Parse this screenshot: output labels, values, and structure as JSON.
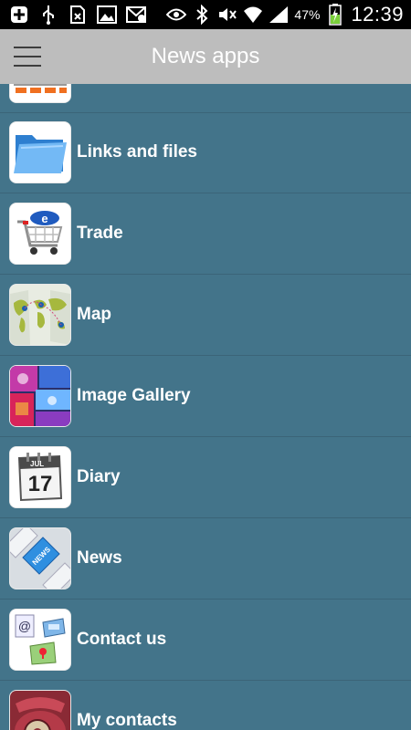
{
  "status_bar": {
    "battery_percent": "47%",
    "time": "12:39",
    "icons": [
      "plus-icon",
      "usb-icon",
      "no-sim-icon",
      "image-icon",
      "mail-icon",
      "eye-icon",
      "bluetooth-icon",
      "silent-icon",
      "wifi-icon",
      "signal-icon",
      "battery-charging-icon"
    ]
  },
  "app_bar": {
    "title": "News apps",
    "menu_icon": "hamburger-menu-icon"
  },
  "list": {
    "items": [
      {
        "label": "",
        "icon": "partial-app-icon"
      },
      {
        "label": "Links and files",
        "icon": "folder-icon"
      },
      {
        "label": "Trade",
        "icon": "shopping-cart-icon"
      },
      {
        "label": "Map",
        "icon": "world-map-icon"
      },
      {
        "label": "Image Gallery",
        "icon": "image-gallery-icon"
      },
      {
        "label": "Diary",
        "icon": "calendar-icon"
      },
      {
        "label": "News",
        "icon": "news-key-icon"
      },
      {
        "label": "Contact us",
        "icon": "contact-icons-icon"
      },
      {
        "label": "My contacts",
        "icon": "rotary-phone-icon"
      }
    ],
    "calendar": {
      "month": "JUL",
      "day": "17"
    },
    "news_key_text": "NEWS"
  }
}
